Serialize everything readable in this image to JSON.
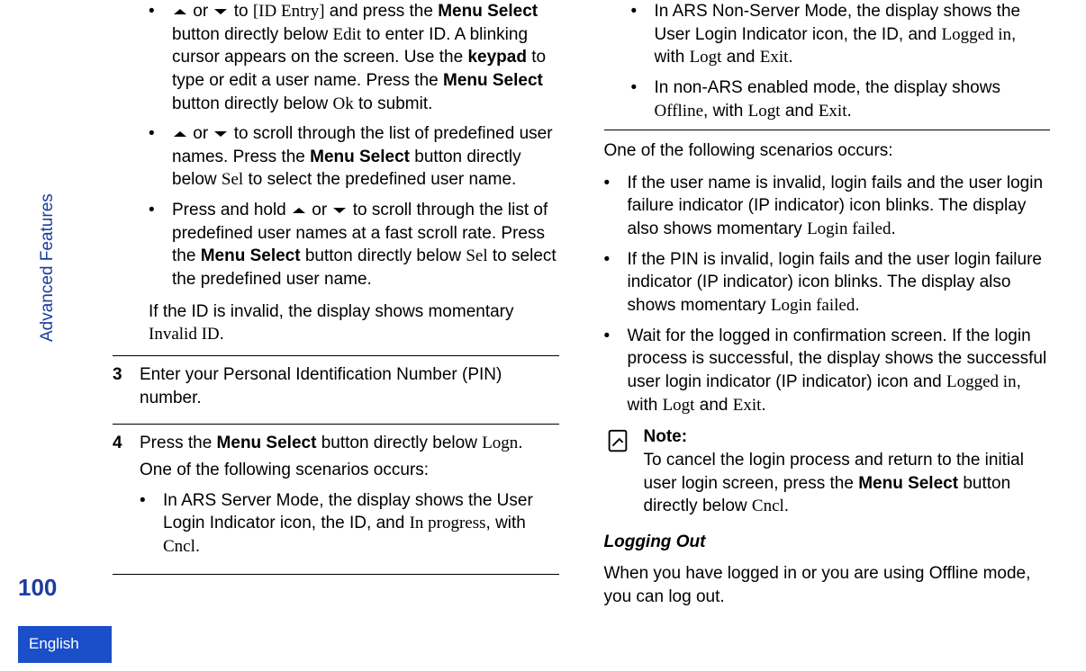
{
  "sidebar": {
    "section_label": "Advanced Features",
    "page_number": "100",
    "language": "English"
  },
  "col1": {
    "bullets": [
      {
        "pre": " or ",
        "mid": " to ",
        "target": "[ID Entry]",
        "tail1": " and press the ",
        "b1": "Menu Select",
        "tail2": " button directly below ",
        "m1": "Edit",
        "tail3": " to enter ID. A blinking cursor appears on the screen. Use the ",
        "b2": "keypad",
        "tail4": " to type or edit a user name. Press the ",
        "b3": "Menu Select",
        "tail5": " button directly below ",
        "m2": "Ok",
        "tail6": " to submit."
      },
      {
        "pre": " or ",
        "mid": " to scroll through the list of predefined user names. Press the ",
        "b1": "Menu Select",
        "tail1": " button directly below ",
        "m1": "Sel",
        "tail2": " to select the predefined user name."
      },
      {
        "pre": "Press and hold ",
        "mid": " or ",
        "tail0": " to scroll through the list of predefined user names at a fast scroll rate. Press the ",
        "b1": "Menu Select",
        "tail1": " button directly below ",
        "m1": "Sel",
        "tail2": " to select the predefined user name."
      }
    ],
    "invalid_line_a": "If the ID is invalid, the display shows momentary ",
    "invalid_line_b": "Invalid ID",
    "invalid_line_c": ".",
    "step3": {
      "num": "3",
      "text": "Enter your Personal Identification Number (PIN) number."
    },
    "step4": {
      "num": "4",
      "line1a": "Press the ",
      "line1b": "Menu Select",
      "line1c": " button directly below ",
      "line1d": "Logn",
      "line1e": ".",
      "line2": "One of the following scenarios occurs:",
      "sub1a": "In ARS Server Mode, the display shows the User Login Indicator icon, the ID, and ",
      "sub1b": "In progress",
      "sub1c": ", with ",
      "sub1d": "Cncl",
      "sub1e": "."
    }
  },
  "col2": {
    "step4cont": {
      "sub2a": "In ARS Non-Server Mode, the display shows the User Login Indicator icon, the ID, and ",
      "sub2b": "Logged in",
      "sub2c": ", with ",
      "sub2d": "Logt",
      "sub2e": " and ",
      "sub2f": "Exit",
      "sub2g": ".",
      "sub3a": "In non-ARS enabled mode, the display shows ",
      "sub3b": "Offline",
      "sub3c": ", with ",
      "sub3d": "Logt",
      "sub3e": " and ",
      "sub3f": "Exit",
      "sub3g": "."
    },
    "scenarios_intro": "One of the following scenarios occurs:",
    "scenarios": [
      {
        "a": "If the user name is invalid, login fails and the user login failure indicator (IP indicator) icon blinks. The display also shows momentary ",
        "m": "Login failed",
        "b": "."
      },
      {
        "a": "If the PIN is invalid, login fails and the user login failure indicator (IP indicator) icon blinks. The display also shows momentary ",
        "m": "Login failed",
        "b": "."
      },
      {
        "a": "Wait for the logged in confirmation screen. If the login process is successful, the display shows the successful user login indicator (IP indicator) icon and ",
        "m": "Logged in",
        "b": ", with ",
        "m2": "Logt",
        "c": " and ",
        "m3": "Exit",
        "d": "."
      }
    ],
    "note": {
      "title": "Note:",
      "body_a": "To cancel the login process and return to the initial user login screen, press the ",
      "body_b": "Menu Select",
      "body_c": " button directly below ",
      "body_d": "Cncl",
      "body_e": "."
    },
    "logout_heading": "Logging Out",
    "logout_body": "When you have logged in or you are using Offline mode, you can log out."
  }
}
